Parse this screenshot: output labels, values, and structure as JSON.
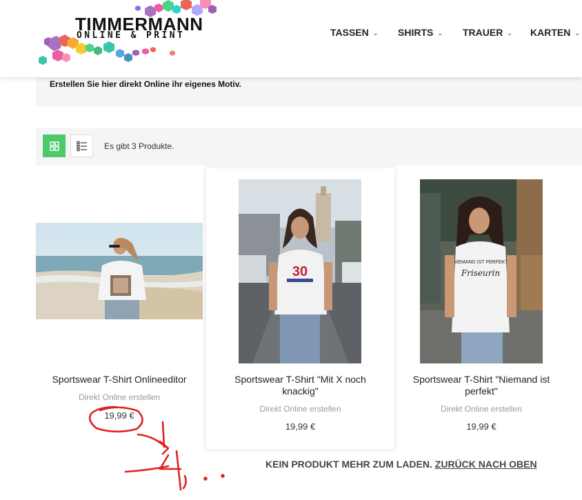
{
  "brand": {
    "name": "TIMMERMANN",
    "tagline": "ONLINE & PRINT"
  },
  "nav": [
    {
      "label": "TASSEN"
    },
    {
      "label": "SHIRTS"
    },
    {
      "label": "TRAUER"
    },
    {
      "label": "KARTEN"
    }
  ],
  "category_description": "Erstellen Sie hier direkt Online ihr eigenes Motiv.",
  "toolbar": {
    "count_text": "Es gibt 3 Produkte."
  },
  "products": [
    {
      "name": "Sportswear T-Shirt Onlineeditor",
      "subtitle": "Direkt Online erstellen",
      "price": "19,99 €",
      "shirt_print": ""
    },
    {
      "name": "Sportswear T-Shirt \"Mit X noch knackig\"",
      "subtitle": "Direkt Online erstellen",
      "price": "19,99 €",
      "shirt_print": "30"
    },
    {
      "name": "Sportswear T-Shirt \"Niemand ist perfekt\"",
      "subtitle": "Direkt Online erstellen",
      "price": "19,99 €",
      "shirt_print": "Friseurin"
    }
  ],
  "load_more": {
    "text": "KEIN PRODUKT MEHR ZUM LADEN.",
    "link": "ZURÜCK NACH OBEN"
  },
  "annotation": {
    "text": "14,.."
  },
  "colors": {
    "accent_green": "#4cc96a",
    "annotation_red": "#e02020"
  }
}
